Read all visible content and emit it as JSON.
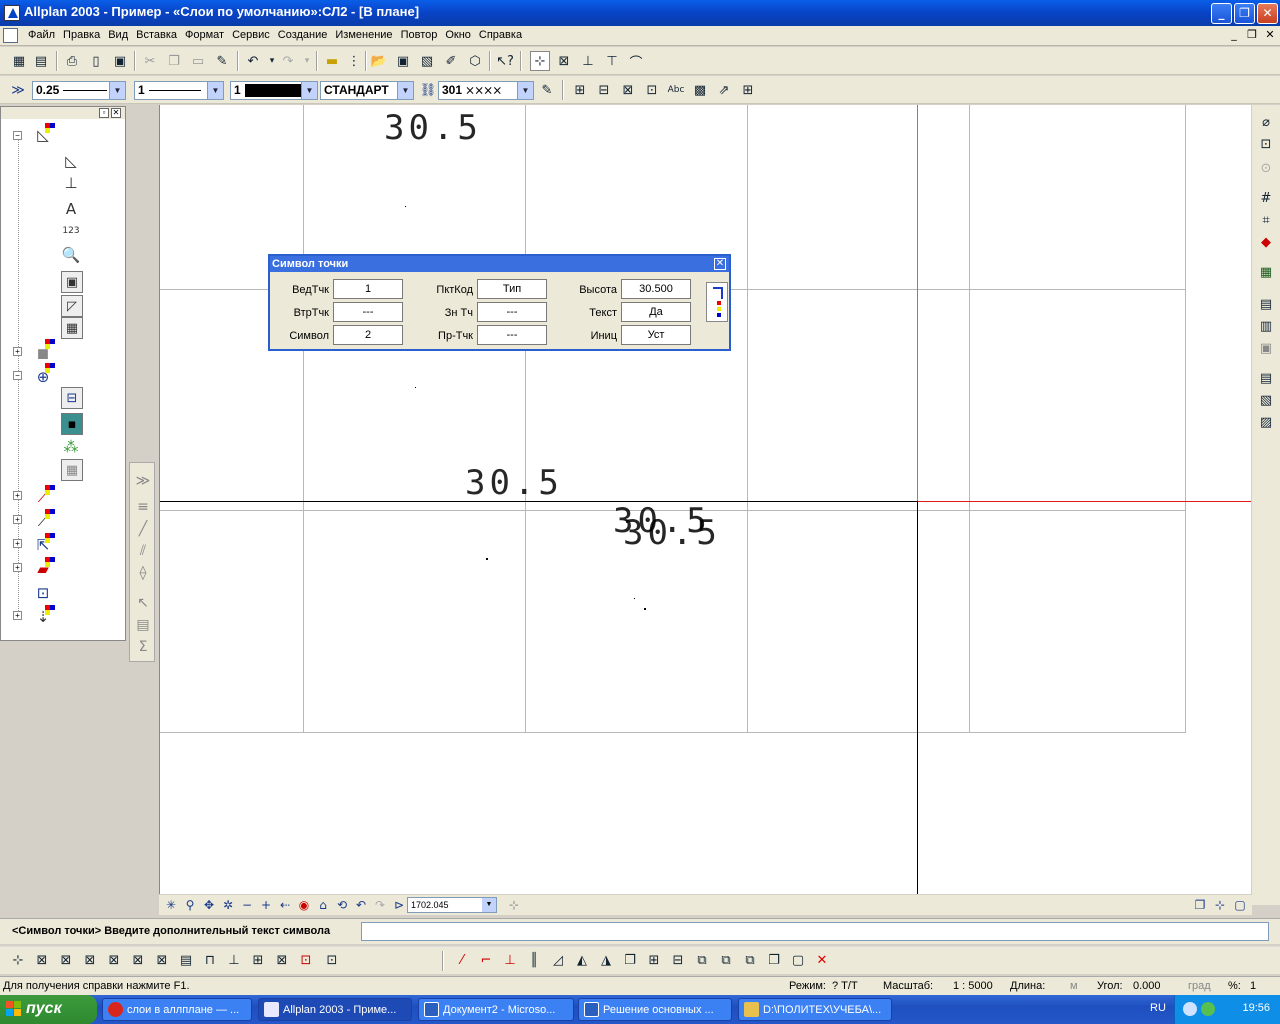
{
  "window": {
    "title": "Allplan 2003 - Пример - «Слои по умолчанию»:СЛ2 - [В плане]",
    "minimize": "_",
    "maximize": "❐",
    "close": "✕"
  },
  "menu": {
    "items": [
      "Файл",
      "Правка",
      "Вид",
      "Вставка",
      "Формат",
      "Сервис",
      "Создание",
      "Изменение",
      "Повтор",
      "Окно",
      "Справка"
    ],
    "mdi_buttons": [
      "_",
      "❐",
      "✕"
    ]
  },
  "format_toolbar": {
    "pen_value": "0.25",
    "line_value": "1",
    "color_value": "1",
    "layer_value": "СТАНДАРТ",
    "pattern_value": "301"
  },
  "canvas": {
    "labels": [
      "30.5",
      "30.5",
      "30.5",
      "30.5"
    ]
  },
  "dialog": {
    "title": "Символ точки",
    "close": "✕",
    "rows": [
      {
        "l1": "ВедТчк",
        "v1": "1",
        "l2": "ПктКод",
        "v2": "Тип",
        "l3": "Высота",
        "v3": "30.500"
      },
      {
        "l1": "ВтрТчк",
        "v1": "---",
        "l2": "Зн Тч",
        "v2": "---",
        "l3": "Текст",
        "v3": "Да"
      },
      {
        "l1": "Символ",
        "v1": "2",
        "l2": "Пр-Тчк",
        "v2": "---",
        "l3": "Иниц",
        "v3": "Уст"
      }
    ]
  },
  "view_toolbar": {
    "zoom_value": "1702.045"
  },
  "prompt": {
    "text": "<Символ точки> Введите дополнительный текст символа",
    "input_value": ""
  },
  "status": {
    "help": "Для получения справки нажмите F1.",
    "mode_label": "Режим:",
    "mode_value": "? Т/Т",
    "scale_label": "Масштаб:",
    "scale_value": "1 : 5000",
    "length_label": "Длина:",
    "length_unit": "м",
    "angle_label": "Угол:",
    "angle_value": "0.000",
    "angle_unit": "град",
    "percent_label": "%:",
    "percent_value": "1"
  },
  "taskbar": {
    "start": "пуск",
    "tasks": [
      {
        "label": "слои в аллплане — ...",
        "color": "#d9261c"
      },
      {
        "label": "Allplan 2003 - Приме...",
        "color": "#e8e8ff"
      },
      {
        "label": "Документ2 - Microso...",
        "color": "#2b5fbf"
      },
      {
        "label": "Решение основных ...",
        "color": "#2b5fbf"
      },
      {
        "label": "D:\\ПОЛИТЕХ\\УЧЕБА\\...",
        "color": "#e8c050"
      }
    ],
    "lang": "RU",
    "clock": "19:56"
  },
  "colors": {
    "title_bar": "#0843c6",
    "crosshair_green": "#1ec81e",
    "crosshair_red": "#e01818",
    "grid": "#b8b8b8"
  }
}
